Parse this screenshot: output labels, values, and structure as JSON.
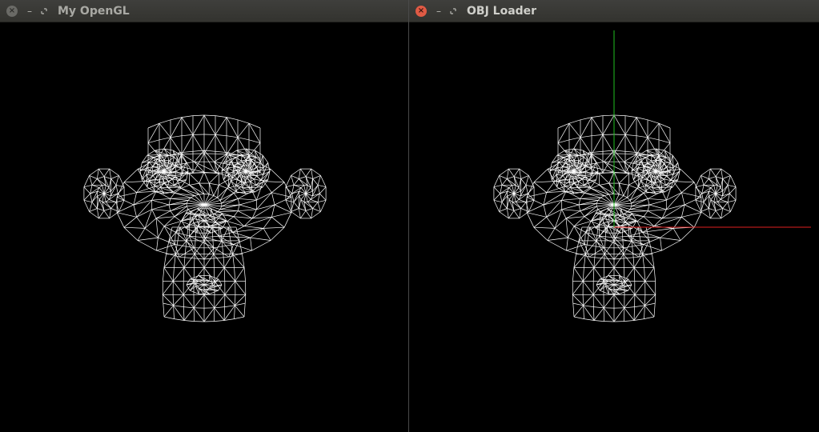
{
  "windows": [
    {
      "title": "My OpenGL",
      "focused": false,
      "buttons": {
        "close_icon": "close-icon",
        "minimize_icon": "minimize-icon",
        "maximize_icon": "maximize-icon"
      },
      "show_axes": false
    },
    {
      "title": "OBJ Loader",
      "focused": true,
      "buttons": {
        "close_icon": "close-icon",
        "minimize_icon": "minimize-icon",
        "maximize_icon": "maximize-icon"
      },
      "show_axes": true
    }
  ],
  "colors": {
    "wireframe": "#ffffff",
    "background": "#000000",
    "axis_x": "#e02020",
    "axis_y": "#20c020",
    "close_active": "#e05a44",
    "close_inactive": "#6a6a66"
  },
  "glyphs": {
    "close": "×",
    "minimize": "–"
  }
}
